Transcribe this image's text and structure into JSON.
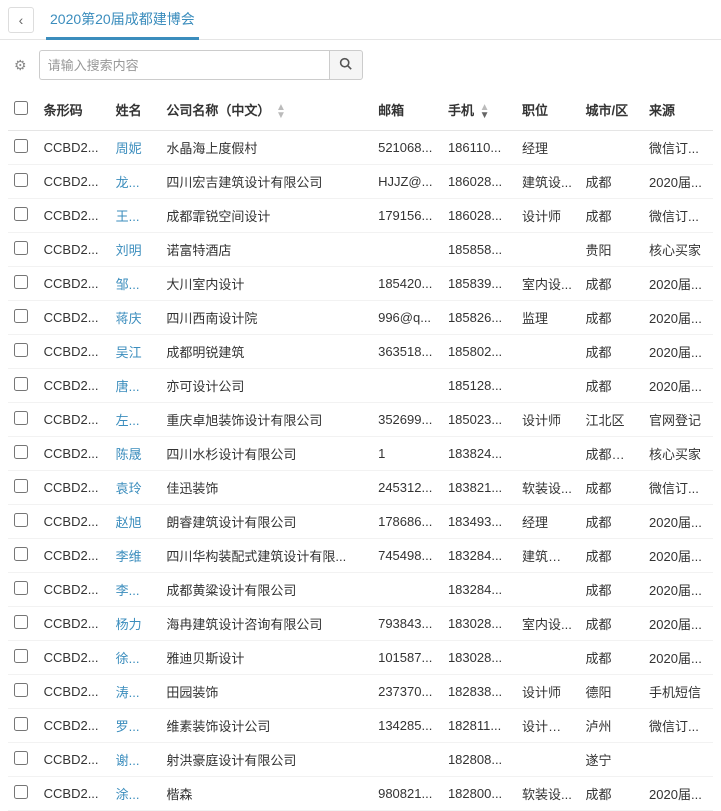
{
  "header": {
    "title": "2020第20届成都建博会"
  },
  "search": {
    "placeholder": "请输入搜索内容"
  },
  "columns": {
    "barcode": "条形码",
    "name": "姓名",
    "company": "公司名称（中文）",
    "email": "邮箱",
    "phone": "手机",
    "job": "职位",
    "city": "城市/区",
    "source": "来源"
  },
  "rows": [
    {
      "barcode": "CCBD2...",
      "name": "周妮",
      "company": "水晶海上度假村",
      "email": "521068...",
      "phone": "186110...",
      "job": "经理",
      "city": "",
      "source": "微信订..."
    },
    {
      "barcode": "CCBD2...",
      "name": "龙...",
      "company": "四川宏吉建筑设计有限公司",
      "email": "HJJZ@...",
      "phone": "186028...",
      "job": "建筑设...",
      "city": "成都",
      "source": "2020届..."
    },
    {
      "barcode": "CCBD2...",
      "name": "王...",
      "company": "成都霏锐空间设计",
      "email": "179156...",
      "phone": "186028...",
      "job": "设计师",
      "city": "成都",
      "source": "微信订..."
    },
    {
      "barcode": "CCBD2...",
      "name": "刘明",
      "company": "诺富特酒店",
      "email": "",
      "phone": "185858...",
      "job": "",
      "city": "贵阳",
      "source": "核心买家"
    },
    {
      "barcode": "CCBD2...",
      "name": "邹...",
      "company": "大川室内设计",
      "email": "185420...",
      "phone": "185839...",
      "job": "室内设...",
      "city": "成都",
      "source": "2020届..."
    },
    {
      "barcode": "CCBD2...",
      "name": "蒋庆",
      "company": "四川西南设计院",
      "email": "996@q...",
      "phone": "185826...",
      "job": "监理",
      "city": "成都",
      "source": "2020届..."
    },
    {
      "barcode": "CCBD2...",
      "name": "吴江",
      "company": "成都明锐建筑",
      "email": "363518...",
      "phone": "185802...",
      "job": "",
      "city": "成都",
      "source": "2020届..."
    },
    {
      "barcode": "CCBD2...",
      "name": "唐...",
      "company": "亦可设计公司",
      "email": "",
      "phone": "185128...",
      "job": "",
      "city": "成都",
      "source": "2020届..."
    },
    {
      "barcode": "CCBD2...",
      "name": "左...",
      "company": "重庆卓旭装饰设计有限公司",
      "email": "352699...",
      "phone": "185023...",
      "job": "设计师",
      "city": "江北区",
      "source": "官网登记"
    },
    {
      "barcode": "CCBD2...",
      "name": "陈晟",
      "company": "四川水杉设计有限公司",
      "email": "1",
      "phone": "183824...",
      "job": "",
      "city": "成都郫县",
      "source": "核心买家"
    },
    {
      "barcode": "CCBD2...",
      "name": "袁玲",
      "company": "佳迅装饰",
      "email": "245312...",
      "phone": "183821...",
      "job": "软装设...",
      "city": "成都",
      "source": "微信订..."
    },
    {
      "barcode": "CCBD2...",
      "name": "赵旭",
      "company": "朗睿建筑设计有限公司",
      "email": "178686...",
      "phone": "183493...",
      "job": "经理",
      "city": "成都",
      "source": "2020届..."
    },
    {
      "barcode": "CCBD2...",
      "name": "李维",
      "company": "四川华构装配式建筑设计有限...",
      "email": "745498...",
      "phone": "183284...",
      "job": "建筑装饰",
      "city": "成都",
      "source": "2020届..."
    },
    {
      "barcode": "CCBD2...",
      "name": "李...",
      "company": "成都黄粱设计有限公司",
      "email": "",
      "phone": "183284...",
      "job": "",
      "city": "成都",
      "source": "2020届..."
    },
    {
      "barcode": "CCBD2...",
      "name": "杨力",
      "company": "海冉建筑设计咨询有限公司",
      "email": "793843...",
      "phone": "183028...",
      "job": "室内设...",
      "city": "成都",
      "source": "2020届..."
    },
    {
      "barcode": "CCBD2...",
      "name": "徐...",
      "company": "雅迪贝斯设计",
      "email": "101587...",
      "phone": "183028...",
      "job": "",
      "city": "成都",
      "source": "2020届..."
    },
    {
      "barcode": "CCBD2...",
      "name": "涛...",
      "company": "田园装饰",
      "email": "237370...",
      "phone": "182838...",
      "job": "设计师",
      "city": "德阳",
      "source": "手机短信"
    },
    {
      "barcode": "CCBD2...",
      "name": "罗...",
      "company": "维素装饰设计公司",
      "email": "134285...",
      "phone": "182811...",
      "job": "设计经理",
      "city": "泸州",
      "source": "微信订..."
    },
    {
      "barcode": "CCBD2...",
      "name": "谢...",
      "company": "射洪豪庭设计有限公司",
      "email": "",
      "phone": "182808...",
      "job": "",
      "city": "遂宁",
      "source": ""
    },
    {
      "barcode": "CCBD2...",
      "name": "涂...",
      "company": "楷森",
      "email": "980821...",
      "phone": "182800...",
      "job": "软装设...",
      "city": "成都",
      "source": "2020届..."
    }
  ]
}
